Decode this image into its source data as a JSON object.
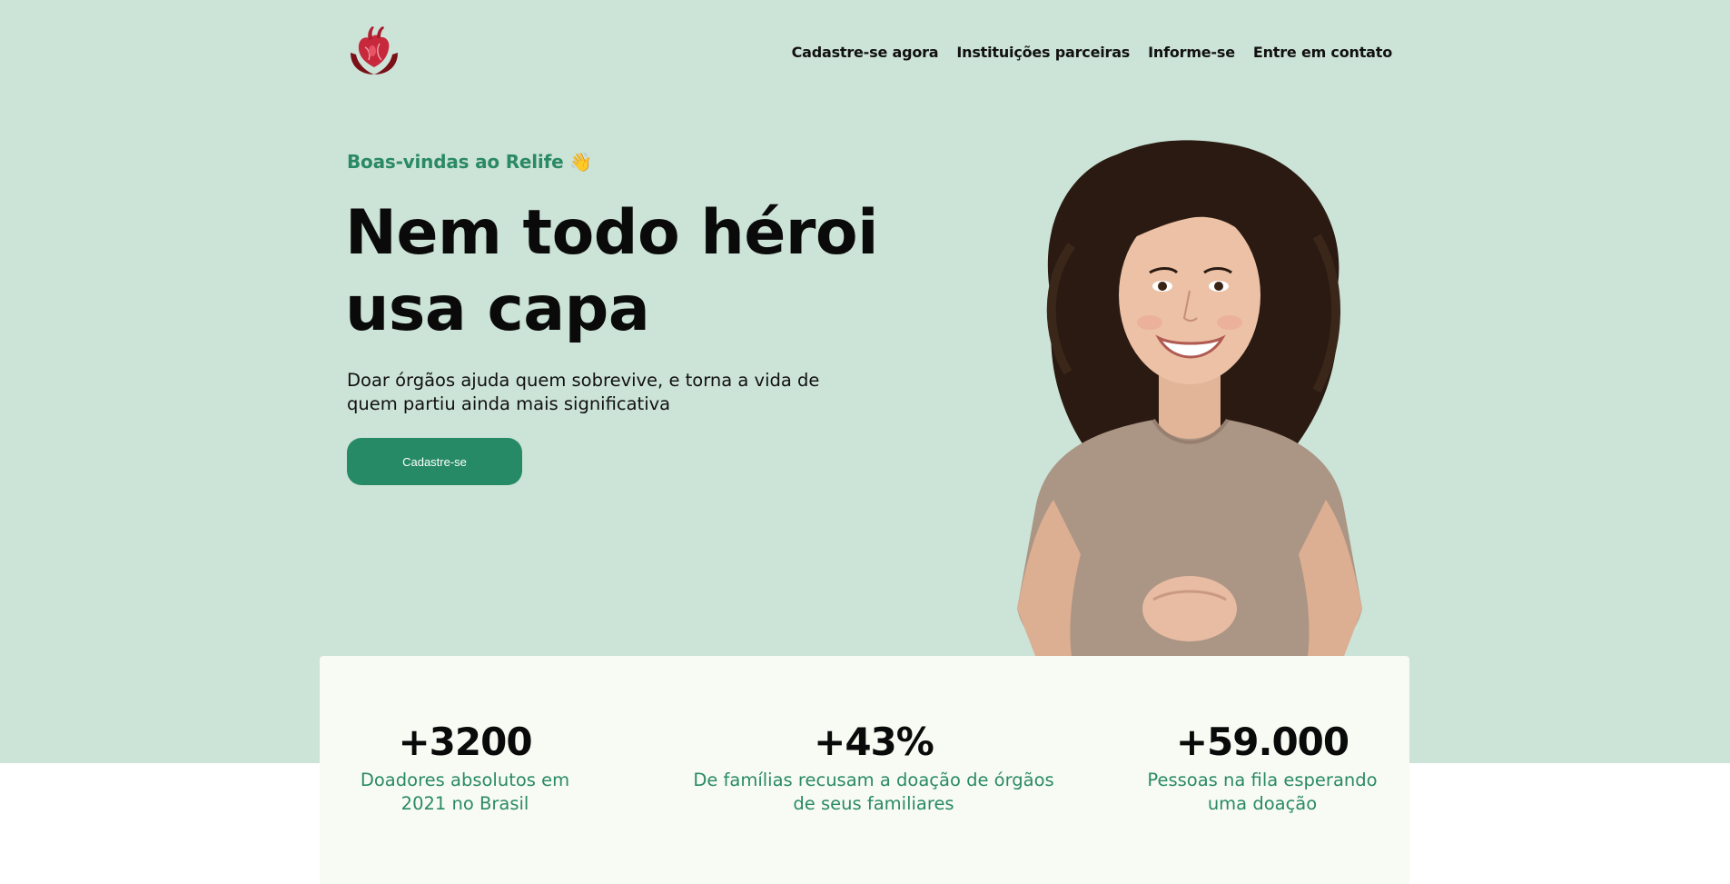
{
  "nav": {
    "items": [
      {
        "label": "Cadastre-se agora"
      },
      {
        "label": "Instituições parceiras"
      },
      {
        "label": "Informe-se"
      },
      {
        "label": "Entre em contato"
      }
    ]
  },
  "logo": {
    "icon": "heart-in-hands-icon"
  },
  "hero": {
    "eyebrow": "Boas-vindas ao Relife 👋",
    "headline": "Nem todo héroi usa capa",
    "subtext": "Doar órgãos ajuda quem sobrevive, e torna a vida de quem partiu ainda mais significativa",
    "cta_label": "Cadastre-se",
    "image": "smiling-woman-photo"
  },
  "stats": [
    {
      "value": "+3200",
      "label": "Doadores absolutos em 2021 no Brasil"
    },
    {
      "value": "+43%",
      "label": "De famílias recusam a doação de órgãos de seus familiares"
    },
    {
      "value": "+59.000",
      "label": "Pessoas na fila esperando uma doação"
    }
  ],
  "colors": {
    "hero_bg": "#cce3d7",
    "accent_green": "#268a66",
    "card_bg": "#f8fbf3",
    "logo_red": "#8a1220"
  }
}
